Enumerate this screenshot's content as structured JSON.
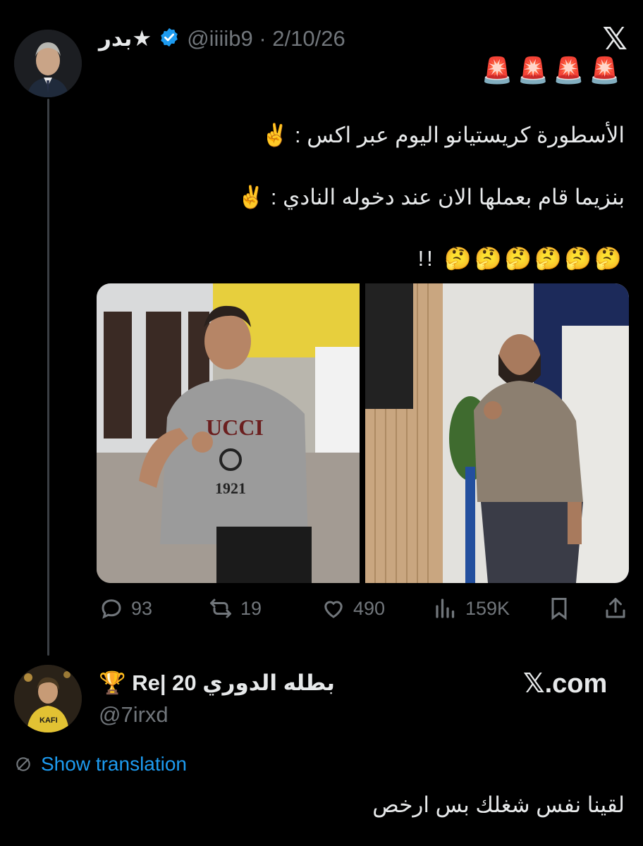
{
  "tweet": {
    "author_name": "بدر★",
    "handle_and_date": "@iiiib9 · 2/10/26",
    "alert_emojis": "🚨🚨🚨🚨",
    "line1": "الأسطورة كريستيانو اليوم عبر اكس : ✌️",
    "line2": "بنزيما قام بعملها الان عند دخوله النادي : ✌️",
    "line3": "🤔🤔🤔🤔🤔🤔 !!",
    "actions": {
      "replies": "93",
      "retweets": "19",
      "likes": "490",
      "views": "159K"
    }
  },
  "reply": {
    "author_name": "بطله الدوري 20 |Re 🏆",
    "handle": "@7irxd",
    "show_translation": "Show translation",
    "text": "لقينا نفس شغلك بس ارخص"
  },
  "brand": {
    "x_logo": "𝕏",
    "x_domain": "𝕏.com"
  },
  "colors": {
    "background": "#000000",
    "text": "#e7e9ea",
    "muted": "#71767b",
    "link": "#1d9bf0",
    "verified": "#1d9bf0"
  }
}
